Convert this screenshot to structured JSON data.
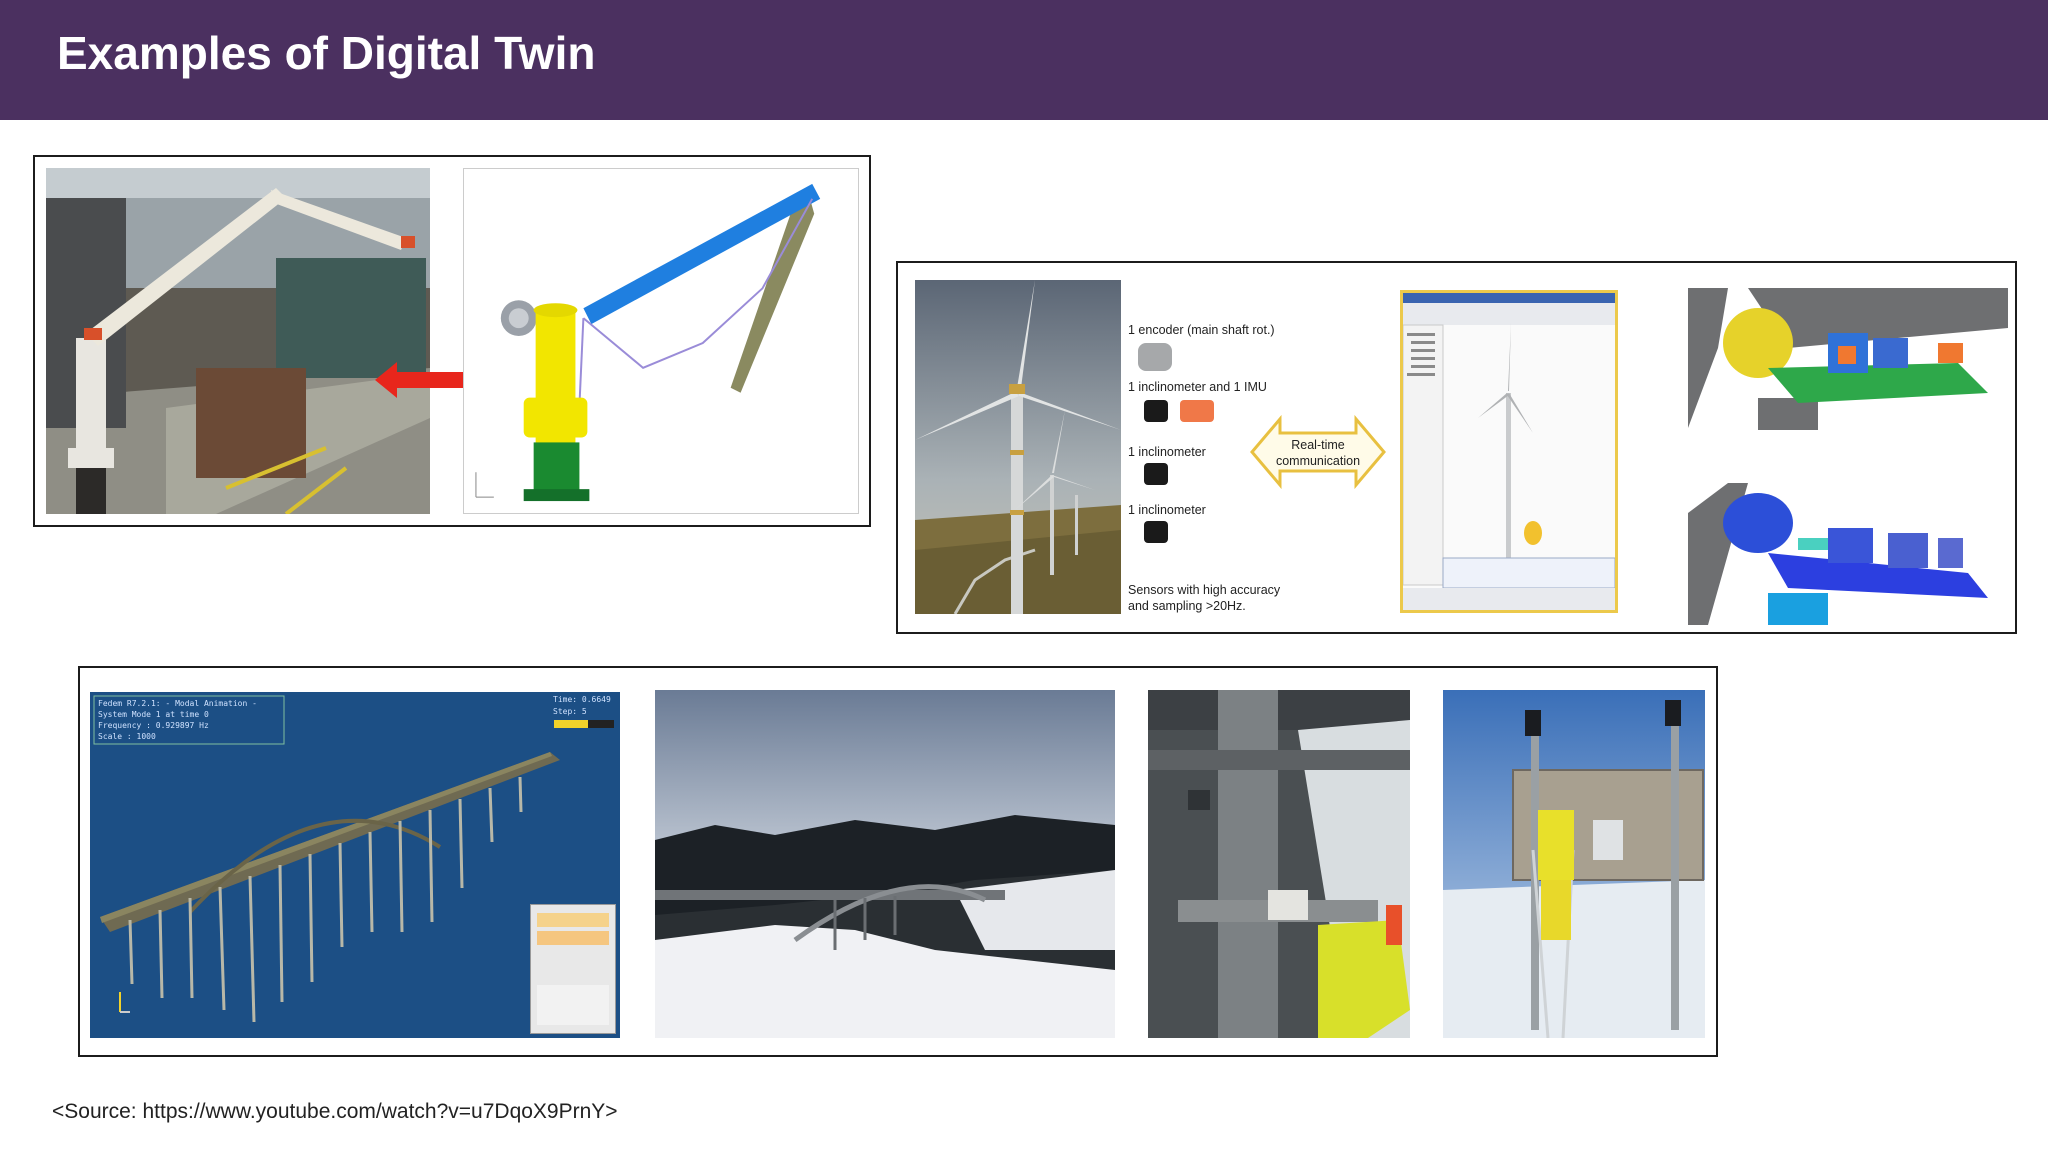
{
  "header": {
    "title": "Examples of Digital Twin"
  },
  "wind_panel": {
    "sensor_labels": [
      "1 encoder (main shaft rot.)",
      "1 inclinometer and 1 IMU",
      "1 inclinometer",
      "1 inclinometer"
    ],
    "sensors_note_line1": "Sensors with high accuracy",
    "sensors_note_line2": "and sampling >20Hz.",
    "comm_line1": "Real-time",
    "comm_line2": "communication"
  },
  "bridge_panel": {
    "hud_lines": [
      "Fedem R7.2.1: - Modal Animation -",
      "System Mode 1 at time 0",
      "Frequency : 0.929897 Hz",
      "Scale : 1000"
    ],
    "time_label": "Time: 0.6649",
    "step_label": "Step: 5"
  },
  "footer": {
    "source": "<Source: https://www.youtube.com/watch?v=u7DqoX9PrnY>"
  },
  "colors": {
    "header_bg": "#4b3060",
    "title_text": "#ffffff",
    "arrow": "#e8261c",
    "crane_yellow": "#f2e600",
    "crane_blue": "#1f7fe0"
  }
}
